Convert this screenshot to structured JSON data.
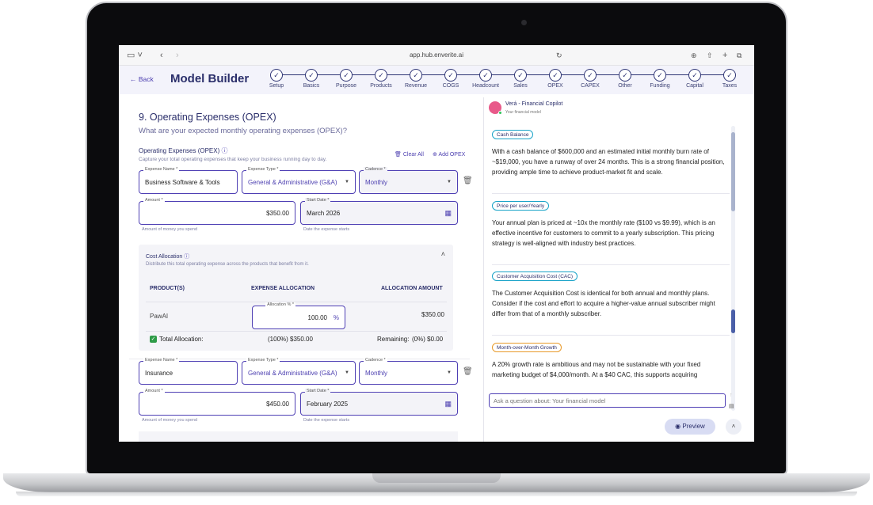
{
  "browser": {
    "url": "app.hub.enverite.ai"
  },
  "header": {
    "back_label": "Back",
    "title": "Model Builder",
    "steps": [
      "Setup",
      "Basics",
      "Purpose",
      "Products",
      "Revenue",
      "COGS",
      "Headcount",
      "Sales",
      "OPEX",
      "CAPEX",
      "Other",
      "Funding",
      "Capital",
      "Taxes"
    ]
  },
  "section": {
    "title": "9. Operating Expenses (OPEX)",
    "question": "What are your expected monthly operating expenses (OPEX)?",
    "opex_label": "Operating Expenses (OPEX)",
    "opex_desc": "Capture your total operating expenses that keep your business running day to day.",
    "clear_all": "Clear All",
    "add_opex": "Add OPEX"
  },
  "expenses": [
    {
      "name_label": "Expense Name *",
      "name": "Business Software & Tools",
      "type_label": "Expense Type *",
      "type": "General & Administrative (G&A)",
      "cadence_label": "Cadence *",
      "cadence": "Monthly",
      "amount_label": "Amount *",
      "amount": "$350.00",
      "start_label": "Start Date *",
      "start": "March 2026",
      "amount_helper": "Amount of money you spend",
      "start_helper": "Date the expense starts"
    },
    {
      "name_label": "Expense Name *",
      "name": "Insurance",
      "type_label": "Expense Type *",
      "type": "General & Administrative (G&A)",
      "cadence_label": "Cadence *",
      "cadence": "Monthly",
      "amount_label": "Amount *",
      "amount": "$450.00",
      "start_label": "Start Date *",
      "start": "February 2025",
      "amount_helper": "Amount of money you spend",
      "start_helper": "Date the expense starts"
    }
  ],
  "allocation": {
    "title": "Cost Allocation",
    "desc": "Distribute this total operating expense across the products that benefit from it.",
    "col_product": "PRODUCT(S)",
    "col_alloc": "EXPENSE ALLOCATION",
    "col_amount": "ALLOCATION AMOUNT",
    "product": "PawAI",
    "alloc_label": "Allocation % *",
    "alloc_value": "100.00",
    "alloc_unit": "%",
    "amount": "$350.00",
    "total_label": "Total Allocation:",
    "total_value": "(100%) $350.00",
    "remaining_label": "Remaining:",
    "remaining_value": "(0%) $0.00"
  },
  "copilot": {
    "name": "Verá - Financial Copilot",
    "subtitle": "Your financial model",
    "cards": [
      {
        "badge": "Cash Balance",
        "color": "#1aa3c8",
        "text": "With a cash balance of $600,000 and an estimated initial monthly burn rate of ~$19,000, you have a runway of over 24 months. This is a strong financial position, providing ample time to achieve product-market fit and scale."
      },
      {
        "badge": "Price per user/Yearly",
        "color": "#1aa3c8",
        "text": "Your annual plan is priced at ~10x the monthly rate ($100 vs $9.99), which is an effective incentive for customers to commit to a yearly subscription. This pricing strategy is well-aligned with industry best practices."
      },
      {
        "badge": "Customer Acquisition Cost (CAC)",
        "color": "#1aa3c8",
        "text": "The Customer Acquisition Cost is identical for both annual and monthly plans. Consider if the cost and effort to acquire a higher-value annual subscriber might differ from that of a monthly subscriber."
      },
      {
        "badge": "Month-over-Month Growth",
        "color": "#e89a2a",
        "text": "A 20% growth rate is ambitious and may not be sustainable with your fixed marketing budget of $4,000/month. At a $40 CAC, this supports acquiring"
      }
    ],
    "ask_placeholder": "Ask a question about: Your financial model",
    "preview": "Preview"
  }
}
